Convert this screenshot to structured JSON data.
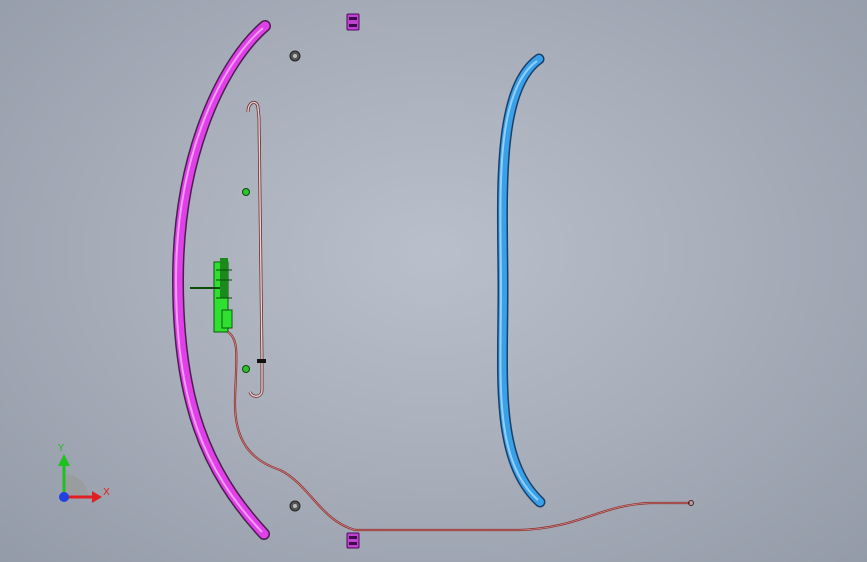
{
  "axes": {
    "x_label": "X",
    "y_label": "Y",
    "x_color": "#e02020",
    "y_color": "#20c020",
    "z_color": "#2040e0"
  },
  "parts": {
    "left_rail_color": "#e040e8",
    "right_rail_color": "#3aa0e8",
    "cable_color": "#8a2a2a",
    "connector_color": "#30e030",
    "clip_color": "#c040d0"
  }
}
